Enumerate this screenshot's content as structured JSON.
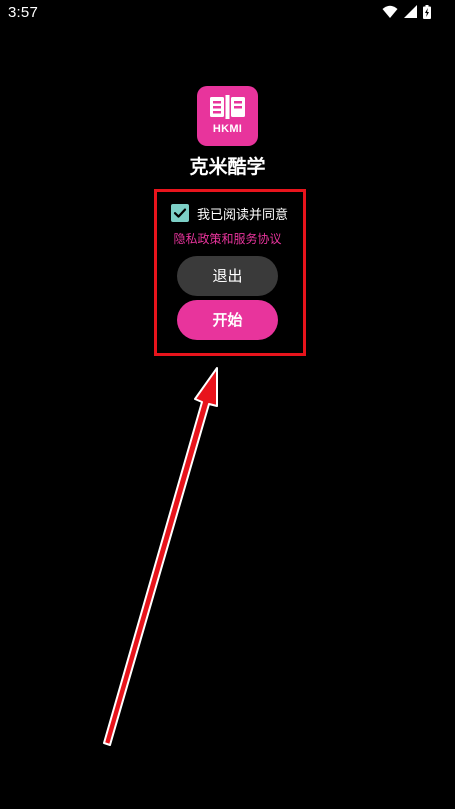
{
  "status_bar": {
    "time": "3:57",
    "icons": [
      "wifi-icon",
      "cell-signal-icon",
      "battery-charging-icon"
    ]
  },
  "app": {
    "icon_text": "HKMI",
    "name": "克米酷学",
    "brand_color": "#e8349c"
  },
  "agreement": {
    "checked": true,
    "label": "我已阅读并同意",
    "policy_link": "隐私政策和服务协议",
    "checkbox_color": "#7ccfc6"
  },
  "buttons": {
    "exit_label": "退出",
    "start_label": "开始"
  },
  "annotation": {
    "highlight_color": "#e8141c",
    "arrow_color": "#e8141c"
  }
}
